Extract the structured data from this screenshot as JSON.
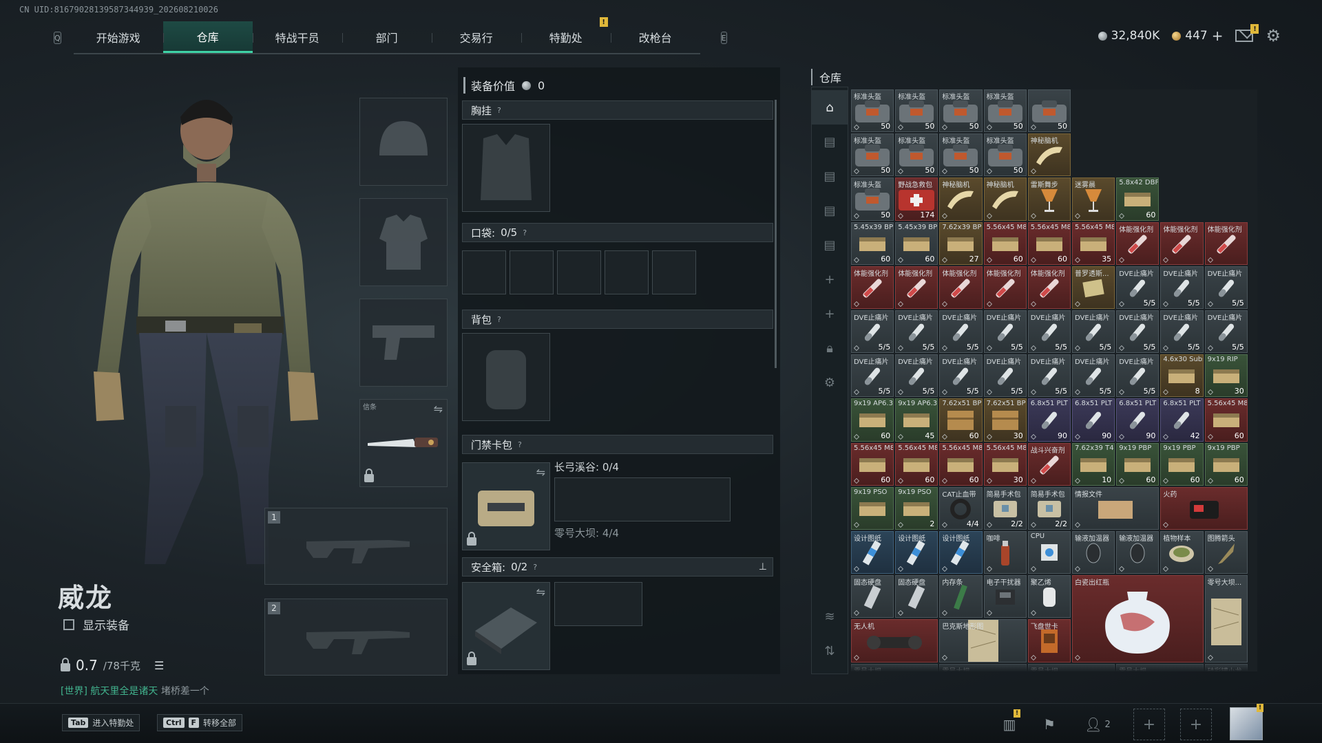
{
  "uid": "CN UID:8167902813958734493​9_202608210026",
  "nav": {
    "left_key": "Q",
    "right_key": "E",
    "tabs": [
      {
        "label": "开始游戏"
      },
      {
        "label": "仓库"
      },
      {
        "label": "特战干员"
      },
      {
        "label": "部门"
      },
      {
        "label": "交易行"
      },
      {
        "label": "特勤处"
      },
      {
        "label": "改枪台"
      }
    ],
    "active_index": 1,
    "warn_tab_index": 5
  },
  "currency": {
    "silver": "32,840K",
    "gold": "447",
    "plus": "+"
  },
  "character": {
    "name": "威龙",
    "show_equipment": "显示装备",
    "weight": "0.7",
    "weight_cap": "/78千克"
  },
  "world_chat": {
    "channel": "[世界] 航天里全是诸天",
    "name": "堵桥差一个"
  },
  "hotkeys": [
    {
      "key": "Tab",
      "label": "进入特勤处"
    },
    {
      "key": "Ctrl",
      "key2": "F",
      "label": "转移全部"
    }
  ],
  "bottom_icons": {
    "friends_count": "2"
  },
  "gear_slots": {
    "knife_label": "信条",
    "weapon1": "1",
    "weapon2": "2"
  },
  "equipment": {
    "title": "装备价值",
    "value": "0",
    "chest": "胸挂",
    "pockets": "口袋:",
    "pockets_count": "0/5",
    "backpack": "背包",
    "keycard": "门禁卡包",
    "key_map1": "长弓溪谷: 0/4",
    "key_map2": "零号大坝: 4/4",
    "safebox": "安全箱:",
    "safebox_count": "0/2",
    "qmark": "?"
  },
  "storage": {
    "title": "仓库",
    "items": [
      {
        "n": "标准头盔",
        "c": "50",
        "k": "bag",
        "col": "",
        "x": 0,
        "y": 0,
        "w": 1,
        "h": 1
      },
      {
        "n": "标准头盔",
        "c": "50",
        "k": "bag",
        "col": "",
        "x": 1,
        "y": 0,
        "w": 1,
        "h": 1
      },
      {
        "n": "标准头盔",
        "c": "50",
        "k": "bag",
        "col": "",
        "x": 2,
        "y": 0,
        "w": 1,
        "h": 1
      },
      {
        "n": "标准头盔",
        "c": "50",
        "k": "bag",
        "col": "",
        "x": 3,
        "y": 0,
        "w": 1,
        "h": 1
      },
      {
        "n": "",
        "c": "50",
        "k": "bag",
        "col": "",
        "x": 4,
        "y": 0,
        "w": 1,
        "h": 1
      },
      {
        "n": "标准头盔",
        "c": "50",
        "k": "bag",
        "col": "",
        "x": 0,
        "y": 1,
        "w": 1,
        "h": 1
      },
      {
        "n": "标准头盔",
        "c": "50",
        "k": "bag",
        "col": "",
        "x": 1,
        "y": 1,
        "w": 1,
        "h": 1
      },
      {
        "n": "标准头盔",
        "c": "50",
        "k": "bag",
        "col": "",
        "x": 2,
        "y": 1,
        "w": 1,
        "h": 1
      },
      {
        "n": "标准头盔",
        "c": "50",
        "k": "bag",
        "col": "",
        "x": 3,
        "y": 1,
        "w": 1,
        "h": 1
      },
      {
        "n": "神秘脑机",
        "c": "",
        "k": "horn",
        "col": "gold",
        "x": 4,
        "y": 1,
        "w": 1,
        "h": 1
      },
      {
        "n": "标准头盔",
        "c": "50",
        "k": "bag",
        "col": "",
        "x": 0,
        "y": 2,
        "w": 1,
        "h": 1
      },
      {
        "n": "野战急救包",
        "c": "174",
        "k": "med",
        "col": "red",
        "x": 1,
        "y": 2,
        "w": 1,
        "h": 1
      },
      {
        "n": "神秘脑机",
        "c": "",
        "k": "horn",
        "col": "gold",
        "x": 2,
        "y": 2,
        "w": 1,
        "h": 1
      },
      {
        "n": "神秘脑机",
        "c": "",
        "k": "horn",
        "col": "gold",
        "x": 3,
        "y": 2,
        "w": 1,
        "h": 1
      },
      {
        "n": "雷斯舞步",
        "c": "",
        "k": "cup",
        "col": "gold",
        "x": 4,
        "y": 2,
        "w": 1,
        "h": 1
      },
      {
        "n": "迷雾晨",
        "c": "",
        "k": "cup",
        "col": "gold",
        "x": 5,
        "y": 2,
        "w": 1,
        "h": 1
      },
      {
        "n": "5.8x42 DBP10",
        "c": "60",
        "k": "ammo",
        "col": "green",
        "x": 6,
        "y": 2,
        "w": 1,
        "h": 1
      },
      {
        "n": "5.45x39 BP",
        "c": "60",
        "k": "ammo",
        "col": "",
        "x": 0,
        "y": 3,
        "w": 1,
        "h": 1
      },
      {
        "n": "5.45x39 BP",
        "c": "60",
        "k": "ammo",
        "col": "",
        "x": 1,
        "y": 3,
        "w": 1,
        "h": 1
      },
      {
        "n": "7.62x39 BP",
        "c": "27",
        "k": "ammo",
        "col": "gold",
        "x": 2,
        "y": 3,
        "w": 1,
        "h": 1
      },
      {
        "n": "5.56x45 M855A1",
        "c": "60",
        "k": "ammo",
        "col": "red",
        "x": 3,
        "y": 3,
        "w": 1,
        "h": 1
      },
      {
        "n": "5.56x45 M855A1",
        "c": "60",
        "k": "ammo",
        "col": "red",
        "x": 4,
        "y": 3,
        "w": 1,
        "h": 1
      },
      {
        "n": "5.56x45 M855A1",
        "c": "35",
        "k": "ammo",
        "col": "red",
        "x": 5,
        "y": 3,
        "w": 1,
        "h": 1
      },
      {
        "n": "体能强化剂",
        "c": "",
        "k": "syringe",
        "col": "red",
        "x": 6,
        "y": 3,
        "w": 1,
        "h": 1
      },
      {
        "n": "体能强化剂",
        "c": "",
        "k": "syringe",
        "col": "red",
        "x": 7,
        "y": 3,
        "w": 1,
        "h": 1
      },
      {
        "n": "体能强化剂",
        "c": "",
        "k": "syringe",
        "col": "red",
        "x": 8,
        "y": 3,
        "w": 1,
        "h": 1
      },
      {
        "n": "体能强化剂",
        "c": "",
        "k": "syringe",
        "col": "red",
        "x": 0,
        "y": 4,
        "w": 1,
        "h": 1
      },
      {
        "n": "体能强化剂",
        "c": "",
        "k": "syringe",
        "col": "red",
        "x": 1,
        "y": 4,
        "w": 1,
        "h": 1
      },
      {
        "n": "体能强化剂",
        "c": "",
        "k": "syringe",
        "col": "red",
        "x": 2,
        "y": 4,
        "w": 1,
        "h": 1
      },
      {
        "n": "体能强化剂",
        "c": "",
        "k": "syringe",
        "col": "red",
        "x": 3,
        "y": 4,
        "w": 1,
        "h": 1
      },
      {
        "n": "体能强化剂",
        "c": "",
        "k": "syringe",
        "col": "red",
        "x": 4,
        "y": 4,
        "w": 1,
        "h": 1
      },
      {
        "n": "普罗透斯...",
        "c": "",
        "k": "card",
        "col": "gold",
        "x": 5,
        "y": 4,
        "w": 1,
        "h": 1
      },
      {
        "n": "DVE止痛片",
        "c": "5/5",
        "k": "pill",
        "col": "",
        "x": 6,
        "y": 4,
        "w": 1,
        "h": 1
      },
      {
        "n": "DVE止痛片",
        "c": "5/5",
        "k": "pill",
        "col": "",
        "x": 7,
        "y": 4,
        "w": 1,
        "h": 1
      },
      {
        "n": "DVE止痛片",
        "c": "5/5",
        "k": "pill",
        "col": "",
        "x": 8,
        "y": 4,
        "w": 1,
        "h": 1
      },
      {
        "n": "DVE止痛片",
        "c": "5/5",
        "k": "pill",
        "col": "",
        "x": 0,
        "y": 5,
        "w": 1,
        "h": 1
      },
      {
        "n": "DVE止痛片",
        "c": "5/5",
        "k": "pill",
        "col": "",
        "x": 1,
        "y": 5,
        "w": 1,
        "h": 1
      },
      {
        "n": "DVE止痛片",
        "c": "5/5",
        "k": "pill",
        "col": "",
        "x": 2,
        "y": 5,
        "w": 1,
        "h": 1
      },
      {
        "n": "DVE止痛片",
        "c": "5/5",
        "k": "pill",
        "col": "",
        "x": 3,
        "y": 5,
        "w": 1,
        "h": 1
      },
      {
        "n": "DVE止痛片",
        "c": "5/5",
        "k": "pill",
        "col": "",
        "x": 4,
        "y": 5,
        "w": 1,
        "h": 1
      },
      {
        "n": "DVE止痛片",
        "c": "5/5",
        "k": "pill",
        "col": "",
        "x": 5,
        "y": 5,
        "w": 1,
        "h": 1
      },
      {
        "n": "DVE止痛片",
        "c": "5/5",
        "k": "pill",
        "col": "",
        "x": 6,
        "y": 5,
        "w": 1,
        "h": 1
      },
      {
        "n": "DVE止痛片",
        "c": "5/5",
        "k": "pill",
        "col": "",
        "x": 7,
        "y": 5,
        "w": 1,
        "h": 1
      },
      {
        "n": "DVE止痛片",
        "c": "5/5",
        "k": "pill",
        "col": "",
        "x": 8,
        "y": 5,
        "w": 1,
        "h": 1
      },
      {
        "n": "DVE止痛片",
        "c": "5/5",
        "k": "pill",
        "col": "",
        "x": 0,
        "y": 6,
        "w": 1,
        "h": 1
      },
      {
        "n": "DVE止痛片",
        "c": "5/5",
        "k": "pill",
        "col": "",
        "x": 1,
        "y": 6,
        "w": 1,
        "h": 1
      },
      {
        "n": "DVE止痛片",
        "c": "5/5",
        "k": "pill",
        "col": "",
        "x": 2,
        "y": 6,
        "w": 1,
        "h": 1
      },
      {
        "n": "DVE止痛片",
        "c": "5/5",
        "k": "pill",
        "col": "",
        "x": 3,
        "y": 6,
        "w": 1,
        "h": 1
      },
      {
        "n": "DVE止痛片",
        "c": "5/5",
        "k": "pill",
        "col": "",
        "x": 4,
        "y": 6,
        "w": 1,
        "h": 1
      },
      {
        "n": "DVE止痛片",
        "c": "5/5",
        "k": "pill",
        "col": "",
        "x": 5,
        "y": 6,
        "w": 1,
        "h": 1
      },
      {
        "n": "DVE止痛片",
        "c": "5/5",
        "k": "pill",
        "col": "",
        "x": 6,
        "y": 6,
        "w": 1,
        "h": 1
      },
      {
        "n": "4.6x30 Subsonic",
        "c": "8",
        "k": "ammo",
        "col": "gold",
        "x": 7,
        "y": 6,
        "w": 1,
        "h": 1
      },
      {
        "n": "9x19 RIP",
        "c": "30",
        "k": "ammo",
        "col": "green",
        "x": 8,
        "y": 6,
        "w": 1,
        "h": 1
      },
      {
        "n": "9x19 AP6.3",
        "c": "60",
        "k": "ammo",
        "col": "green",
        "x": 0,
        "y": 7,
        "w": 1,
        "h": 1
      },
      {
        "n": "9x19 AP6.3",
        "c": "45",
        "k": "ammo",
        "col": "green",
        "x": 1,
        "y": 7,
        "w": 1,
        "h": 1
      },
      {
        "n": "7.62x51 BPZ",
        "c": "60",
        "k": "box",
        "col": "gold",
        "x": 2,
        "y": 7,
        "w": 1,
        "h": 1
      },
      {
        "n": "7.62x51 BPZ",
        "c": "30",
        "k": "box",
        "col": "gold",
        "x": 3,
        "y": 7,
        "w": 1,
        "h": 1
      },
      {
        "n": "6.8x51 PLT",
        "c": "90",
        "k": "pill",
        "col": "purple",
        "x": 4,
        "y": 7,
        "w": 1,
        "h": 1
      },
      {
        "n": "6.8x51 PLT",
        "c": "90",
        "k": "pill",
        "col": "purple",
        "x": 5,
        "y": 7,
        "w": 1,
        "h": 1
      },
      {
        "n": "6.8x51 PLT",
        "c": "90",
        "k": "pill",
        "col": "purple",
        "x": 6,
        "y": 7,
        "w": 1,
        "h": 1
      },
      {
        "n": "6.8x51 PLT",
        "c": "42",
        "k": "pill",
        "col": "purple",
        "x": 7,
        "y": 7,
        "w": 1,
        "h": 1
      },
      {
        "n": "5.56x45 M855",
        "c": "60",
        "k": "ammo",
        "col": "red",
        "x": 8,
        "y": 7,
        "w": 1,
        "h": 1
      },
      {
        "n": "5.56x45 M855",
        "c": "60",
        "k": "ammo",
        "col": "red",
        "x": 0,
        "y": 8,
        "w": 1,
        "h": 1
      },
      {
        "n": "5.56x45 M855",
        "c": "60",
        "k": "ammo",
        "col": "red",
        "x": 1,
        "y": 8,
        "w": 1,
        "h": 1
      },
      {
        "n": "5.56x45 M855",
        "c": "60",
        "k": "ammo",
        "col": "red",
        "x": 2,
        "y": 8,
        "w": 1,
        "h": 1
      },
      {
        "n": "5.56x45 M855",
        "c": "30",
        "k": "ammo",
        "col": "red",
        "x": 3,
        "y": 8,
        "w": 1,
        "h": 1
      },
      {
        "n": "战斗兴奋剂",
        "c": "",
        "k": "syringe",
        "col": "red",
        "x": 4,
        "y": 8,
        "w": 1,
        "h": 1
      },
      {
        "n": "7.62x39 T45M",
        "c": "10",
        "k": "ammo",
        "col": "green",
        "x": 5,
        "y": 8,
        "w": 1,
        "h": 1
      },
      {
        "n": "9x19 PBP",
        "c": "60",
        "k": "ammo",
        "col": "green",
        "x": 6,
        "y": 8,
        "w": 1,
        "h": 1
      },
      {
        "n": "9x19 PBP",
        "c": "60",
        "k": "ammo",
        "col": "green",
        "x": 7,
        "y": 8,
        "w": 1,
        "h": 1
      },
      {
        "n": "9x19 PBP",
        "c": "60",
        "k": "ammo",
        "col": "green",
        "x": 8,
        "y": 8,
        "w": 1,
        "h": 1
      },
      {
        "n": "9x19 PSO",
        "c": "",
        "k": "ammo",
        "col": "green",
        "x": 0,
        "y": 9,
        "w": 1,
        "h": 1
      },
      {
        "n": "9x19 PSO",
        "c": "2",
        "k": "ammo",
        "col": "green",
        "x": 1,
        "y": 9,
        "w": 1,
        "h": 1
      },
      {
        "n": "CAT止血带",
        "c": "4/4",
        "k": "tourniquet",
        "col": "",
        "x": 2,
        "y": 9,
        "w": 1,
        "h": 1
      },
      {
        "n": "简易手术包",
        "c": "2/2",
        "k": "kit",
        "col": "",
        "x": 3,
        "y": 9,
        "w": 1,
        "h": 1
      },
      {
        "n": "简易手术包",
        "c": "2/2",
        "k": "kit",
        "col": "",
        "x": 4,
        "y": 9,
        "w": 1,
        "h": 1
      },
      {
        "n": "情报文件",
        "c": "",
        "k": "folder",
        "col": "",
        "x": 5,
        "y": 9,
        "w": 2,
        "h": 1
      },
      {
        "n": "火药",
        "c": "",
        "k": "tnt",
        "col": "red",
        "x": 7,
        "y": 9,
        "w": 2,
        "h": 1
      },
      {
        "n": "设计图纸",
        "c": "",
        "k": "blueprint",
        "col": "blue",
        "x": 0,
        "y": 10,
        "w": 1,
        "h": 1
      },
      {
        "n": "设计图纸",
        "c": "",
        "k": "blueprint",
        "col": "blue",
        "x": 1,
        "y": 10,
        "w": 1,
        "h": 1
      },
      {
        "n": "设计图纸",
        "c": "",
        "k": "blueprint",
        "col": "blue",
        "x": 2,
        "y": 10,
        "w": 1,
        "h": 1
      },
      {
        "n": "咖啡",
        "c": "",
        "k": "bottle",
        "col": "",
        "x": 3,
        "y": 10,
        "w": 1,
        "h": 1
      },
      {
        "n": "CPU",
        "c": "",
        "k": "cpu",
        "col": "",
        "x": 4,
        "y": 10,
        "w": 1,
        "h": 1
      },
      {
        "n": "输液加温器",
        "c": "",
        "k": "mouse",
        "col": "",
        "x": 5,
        "y": 10,
        "w": 1,
        "h": 1
      },
      {
        "n": "输液加温器",
        "c": "",
        "k": "mouse",
        "col": "",
        "x": 6,
        "y": 10,
        "w": 1,
        "h": 1
      },
      {
        "n": "植物样本",
        "c": "",
        "k": "dish",
        "col": "",
        "x": 7,
        "y": 10,
        "w": 1,
        "h": 1
      },
      {
        "n": "图腾箭头",
        "c": "",
        "k": "arrow",
        "col": "",
        "x": 8,
        "y": 10,
        "w": 1,
        "h": 1
      },
      {
        "n": "固态硬盘",
        "c": "",
        "k": "ssd",
        "col": "",
        "x": 0,
        "y": 11,
        "w": 1,
        "h": 1
      },
      {
        "n": "固态硬盘",
        "c": "",
        "k": "ssd",
        "col": "",
        "x": 1,
        "y": 11,
        "w": 1,
        "h": 1
      },
      {
        "n": "内存条",
        "c": "",
        "k": "ram",
        "col": "",
        "x": 2,
        "y": 11,
        "w": 1,
        "h": 1
      },
      {
        "n": "电子干扰器",
        "c": "",
        "k": "board",
        "col": "",
        "x": 3,
        "y": 11,
        "w": 1,
        "h": 1
      },
      {
        "n": "聚乙烯",
        "c": "",
        "k": "roll",
        "col": "",
        "x": 4,
        "y": 11,
        "w": 1,
        "h": 1
      },
      {
        "n": "白瓷出红瓶",
        "c": "",
        "k": "vase",
        "col": "red",
        "x": 5,
        "y": 11,
        "w": 3,
        "h": 2
      },
      {
        "n": "零号大坝...",
        "c": "",
        "k": "map",
        "col": "",
        "x": 8,
        "y": 11,
        "w": 1,
        "h": 2
      },
      {
        "n": "无人机",
        "c": "",
        "k": "drone",
        "col": "red",
        "x": 0,
        "y": 12,
        "w": 2,
        "h": 1
      },
      {
        "n": "巴克斯地形图",
        "c": "",
        "k": "map",
        "col": "",
        "x": 2,
        "y": 12,
        "w": 2,
        "h": 1
      },
      {
        "n": "飞盘世卡",
        "c": "",
        "k": "book",
        "col": "red",
        "x": 4,
        "y": 12,
        "w": 1,
        "h": 1
      },
      {
        "n": "零号大坝...",
        "c": "",
        "k": "none",
        "col": "",
        "x": 0,
        "y": 13,
        "w": 2,
        "h": 1
      },
      {
        "n": "零号大坝...",
        "c": "",
        "k": "none",
        "col": "",
        "x": 2,
        "y": 13,
        "w": 2,
        "h": 1
      },
      {
        "n": "零号大坝...",
        "c": "",
        "k": "none",
        "col": "",
        "x": 4,
        "y": 13,
        "w": 2,
        "h": 1
      },
      {
        "n": "零号大坝...",
        "c": "",
        "k": "none",
        "col": "",
        "x": 6,
        "y": 13,
        "w": 2,
        "h": 1
      },
      {
        "n": "硅彩罐小龙",
        "c": "",
        "k": "none",
        "col": "",
        "x": 8,
        "y": 13,
        "w": 1,
        "h": 1
      }
    ]
  }
}
